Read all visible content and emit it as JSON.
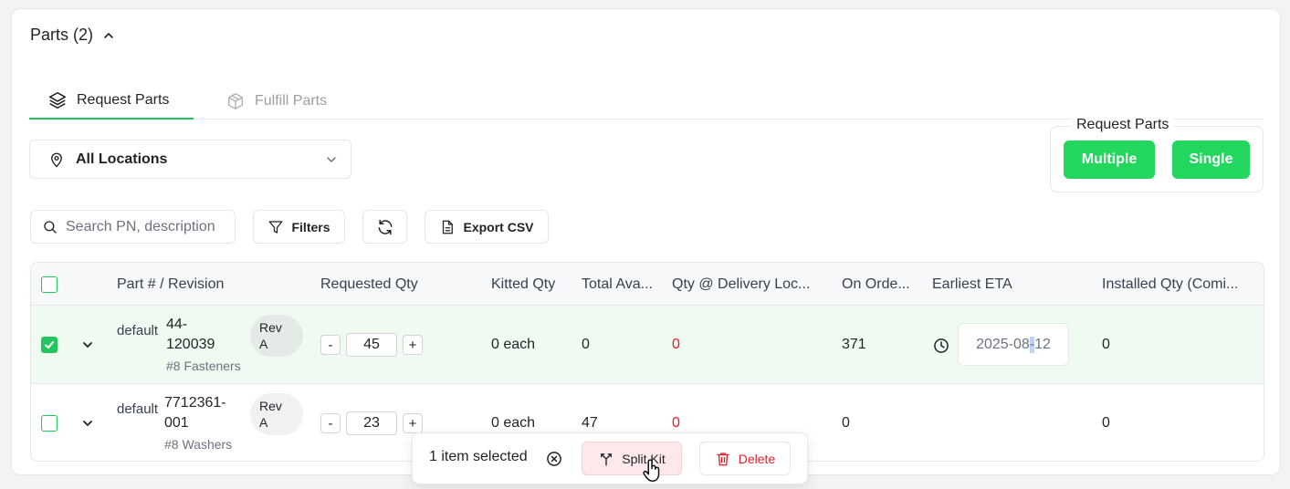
{
  "section": {
    "title": "Parts (2)"
  },
  "tabs": [
    {
      "label": "Request Parts",
      "active": true
    },
    {
      "label": "Fulfill Parts",
      "active": false
    }
  ],
  "location_select": {
    "value": "All Locations"
  },
  "request_parts": {
    "legend": "Request Parts",
    "multiple_label": "Multiple",
    "single_label": "Single"
  },
  "toolbar": {
    "search_placeholder": "Search PN, description",
    "filters_label": "Filters",
    "export_label": "Export CSV"
  },
  "table": {
    "columns": [
      "Part # / Revision",
      "Requested Qty",
      "Kitted Qty",
      "Total Ava...",
      "Qty @ Delivery Loc...",
      "On Orde...",
      "Earliest ETA",
      "Installed Qty (Comi..."
    ],
    "rows": [
      {
        "selected": true,
        "image_alt": "default",
        "part_number_line1": "44-",
        "part_number_line2": "120039",
        "description": "#8 Fasteners",
        "rev_label": "Rev",
        "rev_value": "A",
        "requested_qty": "45",
        "kitted_qty": "0 each",
        "total_available": "0",
        "qty_delivery": "0",
        "on_order": "371",
        "eta_pre": "2025-08",
        "eta_hl": "-",
        "eta_post": "12",
        "installed_qty": "0"
      },
      {
        "selected": false,
        "image_alt": "default",
        "part_number_line1": "7712361-",
        "part_number_line2": "001",
        "description": "#8 Washers",
        "rev_label": "Rev",
        "rev_value": "A",
        "requested_qty": "23",
        "kitted_qty": "0 each",
        "total_available": "47",
        "qty_delivery": "0",
        "on_order": "0",
        "installed_qty": "0"
      }
    ],
    "stepper_minus": "-",
    "stepper_plus": "+"
  },
  "selection_bar": {
    "text": "1 item selected",
    "split_label": "Split Kit",
    "delete_label": "Delete"
  },
  "colors": {
    "accent_green": "#22d65e",
    "danger_red": "#e11d2e",
    "selected_row_bg": "#effaf1"
  },
  "icons": [
    "chevron-up-icon",
    "layers-icon",
    "package-icon",
    "map-pin-icon",
    "chevron-down-icon",
    "search-icon",
    "filter-icon",
    "refresh-icon",
    "file-icon",
    "check-icon",
    "clock-icon",
    "x-circle-icon",
    "split-icon",
    "trash-icon",
    "hand-cursor-icon"
  ]
}
